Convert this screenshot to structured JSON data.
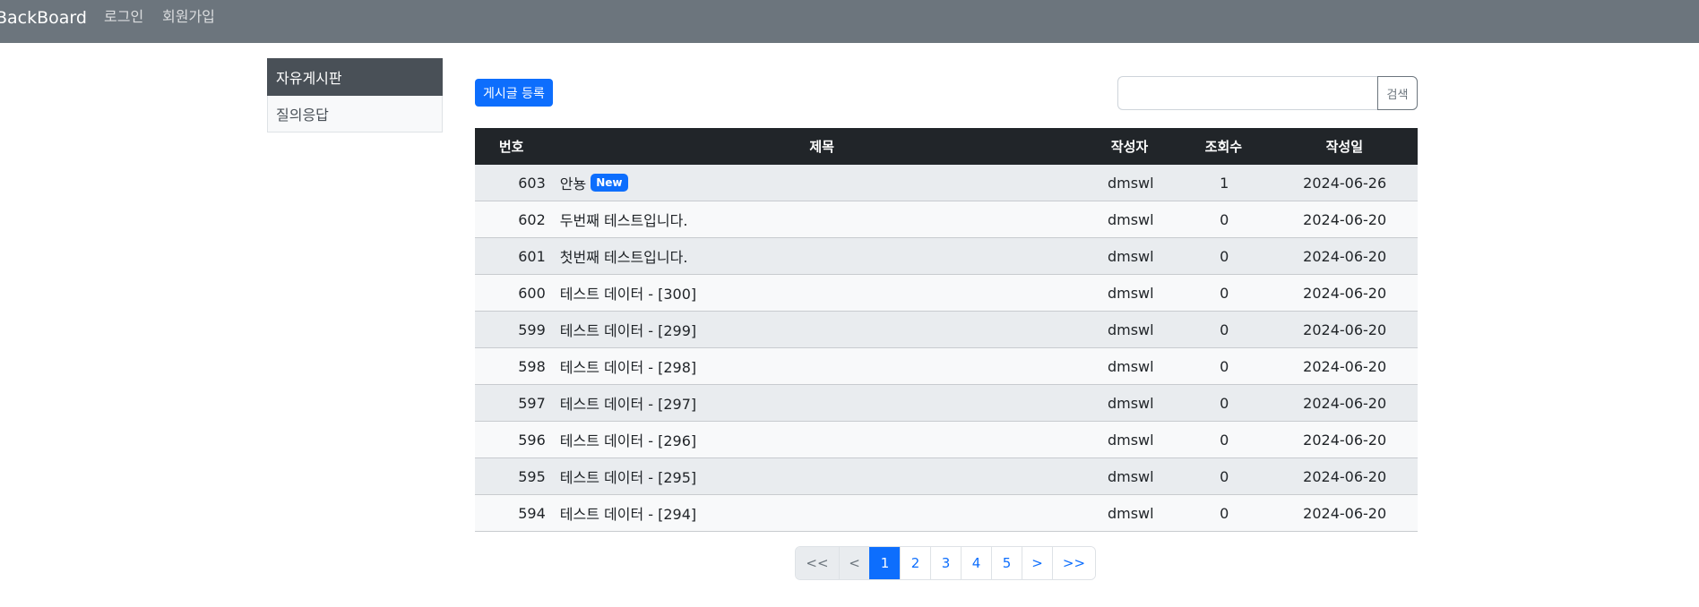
{
  "navbar": {
    "brand": "BackBoard",
    "links": [
      "로그인",
      "회원가입"
    ]
  },
  "sidebar": {
    "items": [
      {
        "label": "자유게시판",
        "active": true
      },
      {
        "label": "질의응답",
        "active": false
      }
    ]
  },
  "toolbar": {
    "write_label": "게시글 등록",
    "search_placeholder": "",
    "search_value": "",
    "search_label": "검색"
  },
  "table": {
    "headers": {
      "no": "번호",
      "title": "제목",
      "author": "작성자",
      "views": "조회수",
      "date": "작성일"
    },
    "new_badge": "New",
    "rows": [
      {
        "no": "603",
        "title": "안뇽",
        "author": "dmswl",
        "views": "1",
        "date": "2024-06-26"
      },
      {
        "no": "602",
        "title": "두번째 테스트입니다.",
        "author": "dmswl",
        "views": "0",
        "date": "2024-06-20"
      },
      {
        "no": "601",
        "title": "첫번째 테스트입니다.",
        "author": "dmswl",
        "views": "0",
        "date": "2024-06-20"
      },
      {
        "no": "600",
        "title": "테스트 데이터 - [300]",
        "author": "dmswl",
        "views": "0",
        "date": "2024-06-20"
      },
      {
        "no": "599",
        "title": "테스트 데이터 - [299]",
        "author": "dmswl",
        "views": "0",
        "date": "2024-06-20"
      },
      {
        "no": "598",
        "title": "테스트 데이터 - [298]",
        "author": "dmswl",
        "views": "0",
        "date": "2024-06-20"
      },
      {
        "no": "597",
        "title": "테스트 데이터 - [297]",
        "author": "dmswl",
        "views": "0",
        "date": "2024-06-20"
      },
      {
        "no": "596",
        "title": "테스트 데이터 - [296]",
        "author": "dmswl",
        "views": "0",
        "date": "2024-06-20"
      },
      {
        "no": "595",
        "title": "테스트 데이터 - [295]",
        "author": "dmswl",
        "views": "0",
        "date": "2024-06-20"
      },
      {
        "no": "594",
        "title": "테스트 데이터 - [294]",
        "author": "dmswl",
        "views": "0",
        "date": "2024-06-20"
      }
    ]
  },
  "pagination": {
    "first": "<<",
    "prev": "<",
    "pages": [
      "1",
      "2",
      "3",
      "4",
      "5"
    ],
    "current": "1",
    "next": ">",
    "last": ">>"
  },
  "colors": {
    "navbar": "#6c757d",
    "accent": "#0d6efd",
    "table_header": "#212529",
    "sidebar_active": "#495057"
  }
}
